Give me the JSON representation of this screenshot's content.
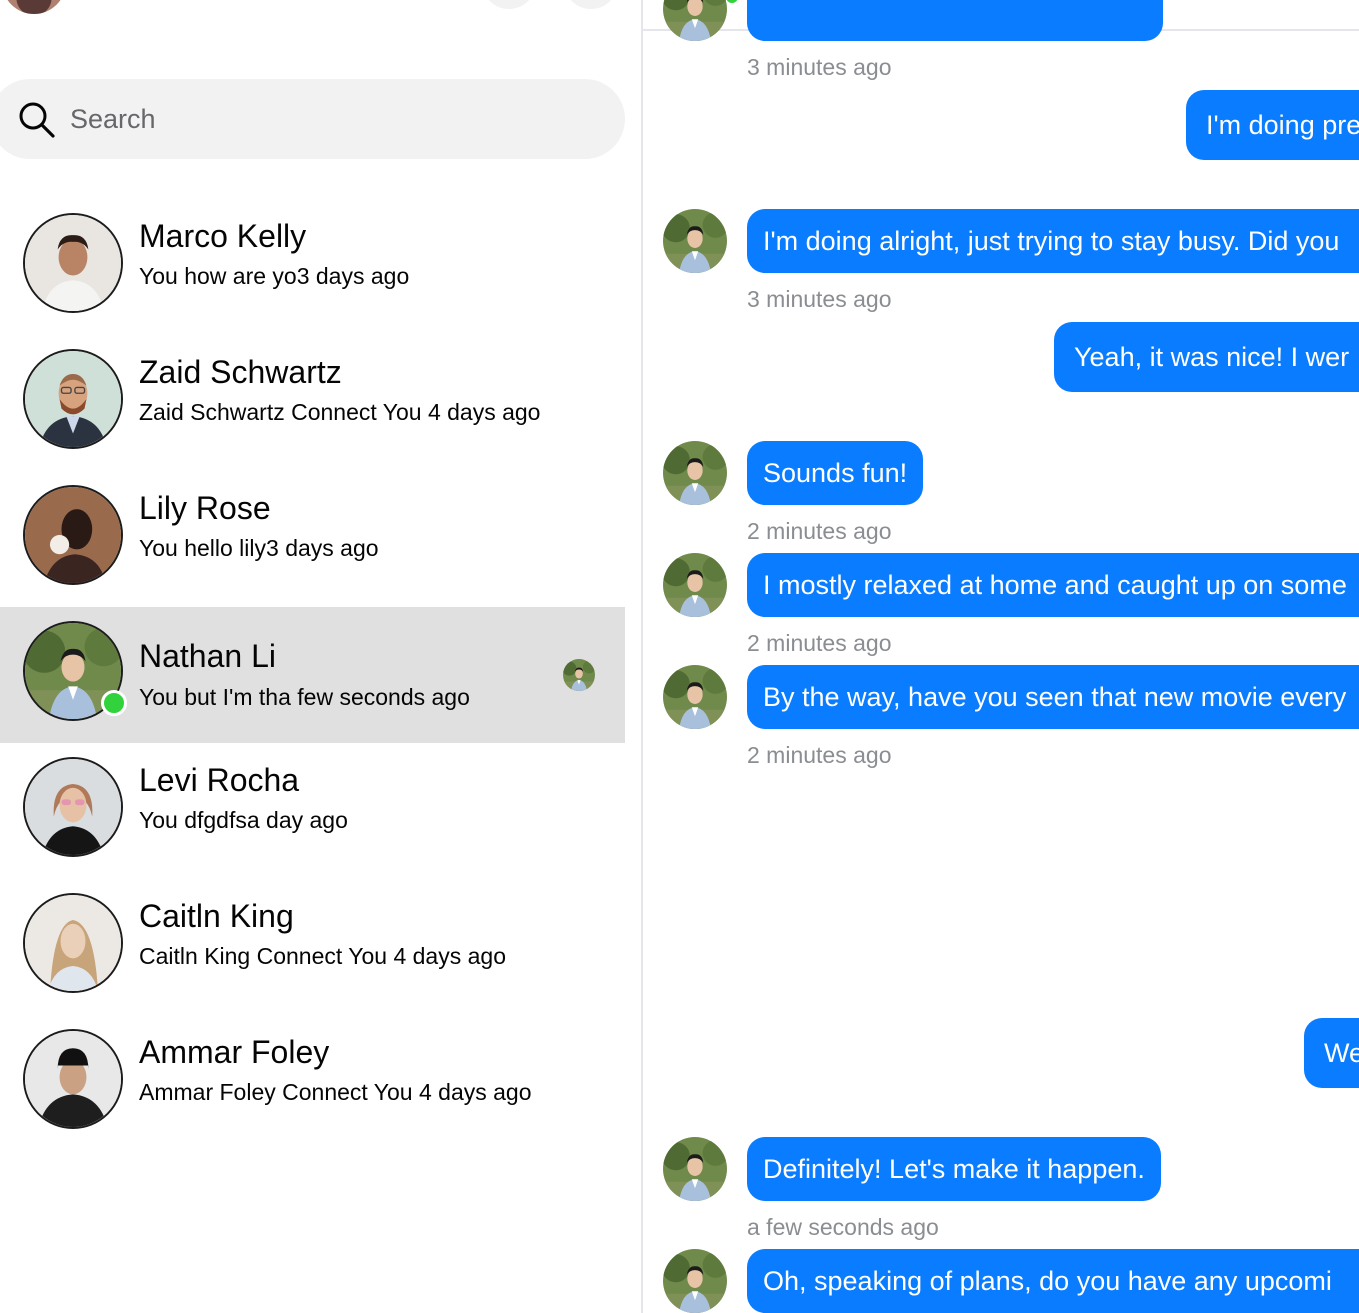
{
  "search": {
    "placeholder": "Search"
  },
  "contacts": [
    {
      "name": "Marco Kelly",
      "preview": "You how are yo3 days ago"
    },
    {
      "name": "Zaid Schwartz",
      "preview": "Zaid Schwartz Connect You 4 days ago"
    },
    {
      "name": "Lily Rose",
      "preview": "You hello lily3 days ago"
    },
    {
      "name": "Nathan Li",
      "preview": "You but I'm tha few seconds ago",
      "online": true,
      "active": true
    },
    {
      "name": "Levi Rocha",
      "preview": "You dfgdfsa day ago"
    },
    {
      "name": "Caitln King",
      "preview": "Caitln King Connect You 4 days ago"
    },
    {
      "name": "Ammar Foley",
      "preview": "Ammar Foley Connect You 4 days ago"
    }
  ],
  "colors": {
    "bubble": "#0a7cff",
    "active_row": "#e0e0e0",
    "online": "#31d23b",
    "timestamp": "#8a8d91"
  },
  "chat": {
    "messages": [
      {
        "from": "them",
        "text": "",
        "time": "3 minutes ago"
      },
      {
        "from": "me",
        "text": "I'm doing pre"
      },
      {
        "from": "them",
        "text": "I'm doing alright, just trying to stay busy. Did you",
        "time": "3 minutes ago"
      },
      {
        "from": "me",
        "text": "Yeah, it was nice! I wer"
      },
      {
        "from": "them",
        "text": "Sounds fun!",
        "time": "2 minutes ago"
      },
      {
        "from": "them",
        "text": "I mostly relaxed at home and caught up on some",
        "time": "2 minutes ago"
      },
      {
        "from": "them",
        "text": "By the way, have you seen that new movie every",
        "time": "2 minutes ago"
      },
      {
        "from": "me",
        "text": "We"
      },
      {
        "from": "them",
        "text": "Definitely! Let's make it happen.",
        "time": "a few seconds ago"
      },
      {
        "from": "them",
        "text": "Oh, speaking of plans, do you have any upcomi"
      }
    ]
  }
}
